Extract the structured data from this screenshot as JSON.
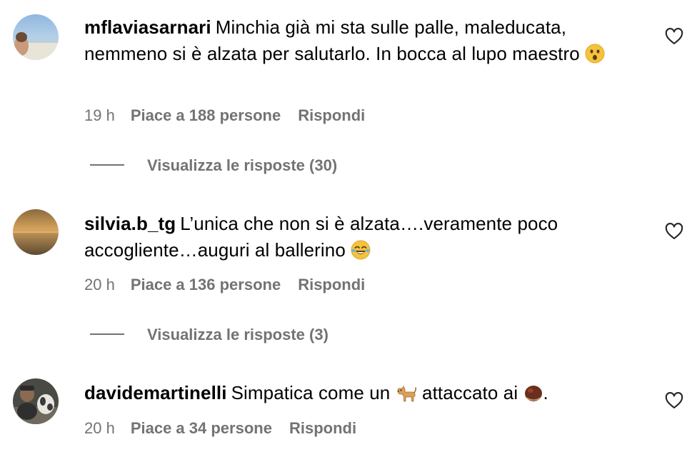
{
  "comments": [
    {
      "username": "mflaviasarnari",
      "text": "Minchia già mi sta sulle palle, maleducata, nemmeno si è alzata per salutarlo. In bocca al lupo maestro",
      "emoji_icon": "astonished-face-emoji",
      "time": "19 h",
      "likes": "Piace a 188 persone",
      "reply": "Rispondi",
      "view_replies": "Visualizza le risposte (30)"
    },
    {
      "username": "silvia.b_tg",
      "text": "L’unica che non si è alzata….veramente poco accogliente…auguri al ballerino",
      "emoji_icon": "face-with-tears-of-joy-emoji",
      "time": "20 h",
      "likes": "Piace a 136 persone",
      "reply": "Rispondi",
      "view_replies": "Visualizza le risposte (3)"
    },
    {
      "username": "davidemartinelli",
      "text_before": "Simpatica come un",
      "text_middle": "attaccato ai",
      "text_after": ".",
      "emoji_icons": [
        "dog-emoji",
        "chestnut-emoji"
      ],
      "time": "20 h",
      "likes": "Piace a 34 persone",
      "reply": "Rispondi"
    }
  ],
  "colors": {
    "text": "#000000",
    "secondary": "#737373",
    "background": "#ffffff"
  },
  "icons": {
    "like": "heart-outline-icon"
  }
}
